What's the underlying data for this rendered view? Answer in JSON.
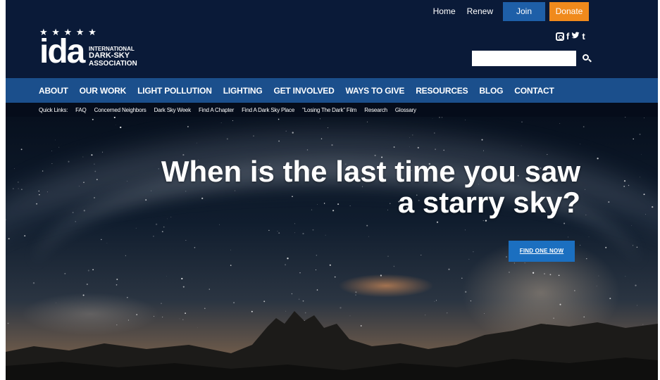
{
  "topnav": {
    "home": "Home",
    "renew": "Renew",
    "join": "Join",
    "donate": "Donate"
  },
  "logo": {
    "wordmark": "ida",
    "line1": "INTERNATIONAL",
    "line2": "DARK-SKY",
    "line3": "ASSOCIATION"
  },
  "social": {
    "icons": [
      "instagram-icon",
      "facebook-icon",
      "twitter-icon",
      "tumblr-icon"
    ],
    "facebook": "f",
    "tumblr": "t"
  },
  "search": {
    "placeholder": "",
    "value": ""
  },
  "mainnav": [
    "ABOUT",
    "OUR WORK",
    "LIGHT POLLUTION",
    "LIGHTING",
    "GET INVOLVED",
    "WAYS TO GIVE",
    "RESOURCES",
    "BLOG",
    "CONTACT"
  ],
  "quick": {
    "label": "Quick Links:",
    "links": [
      "FAQ",
      "Concerned Neighbors",
      "Dark Sky Week",
      "Find A Chapter",
      "Find A Dark Sky Place",
      "\"Losing The Dark\" Film",
      "Research",
      "Glossary"
    ]
  },
  "hero": {
    "headline_line1": "When is the last time you saw",
    "headline_line2": "a starry sky?",
    "cta": "FIND ONE NOW"
  },
  "colors": {
    "header_bg": "#0a1a38",
    "nav_bg": "#1b4f8c",
    "join_bg": "#1e5fa8",
    "donate_bg": "#f08a1c",
    "cta_bg": "#1b6fc0"
  }
}
